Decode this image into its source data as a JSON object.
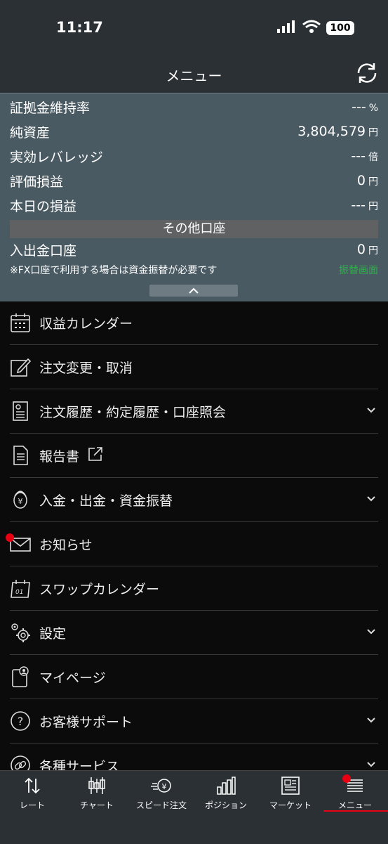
{
  "status": {
    "time": "11:17",
    "battery": "100"
  },
  "header": {
    "title": "メニュー"
  },
  "account": {
    "rows": [
      {
        "label": "証拠金維持率",
        "value": "---",
        "unit": "%"
      },
      {
        "label": "純資産",
        "value": "3,804,579",
        "unit": "円"
      },
      {
        "label": "実効レバレッジ",
        "value": "---",
        "unit": "倍"
      },
      {
        "label": "評価損益",
        "value": "0",
        "unit": "円"
      },
      {
        "label": "本日の損益",
        "value": "---",
        "unit": "円"
      }
    ],
    "other_header": "その他口座",
    "deposit": {
      "label": "入出金口座",
      "value": "0",
      "unit": "円"
    },
    "note": "※FX口座で利用する場合は資金振替が必要です",
    "transfer_link": "振替画面"
  },
  "menu": [
    {
      "label": "収益カレンダー",
      "icon": "calendar-icon"
    },
    {
      "label": "注文変更・取消",
      "icon": "edit-icon"
    },
    {
      "label": "注文履歴・約定履歴・口座照会",
      "icon": "history-doc-icon"
    },
    {
      "label": "報告書",
      "icon": "report-doc-icon"
    },
    {
      "label": "入金・出金・資金振替",
      "icon": "yen-coins-icon"
    },
    {
      "label": "お知らせ",
      "icon": "mail-icon"
    },
    {
      "label": "スワップカレンダー",
      "icon": "swap-calendar-icon"
    },
    {
      "label": "設定",
      "icon": "gear-icon"
    },
    {
      "label": "マイページ",
      "icon": "mypage-icon"
    },
    {
      "label": "お客様サポート",
      "icon": "support-icon"
    },
    {
      "label": "各種サービス",
      "icon": "link-icon"
    }
  ],
  "tabs": [
    {
      "label": "レート",
      "icon": "rate-arrows-icon"
    },
    {
      "label": "チャート",
      "icon": "candlestick-icon"
    },
    {
      "label": "スピード注文",
      "icon": "speed-order-icon"
    },
    {
      "label": "ポジション",
      "icon": "position-bars-icon"
    },
    {
      "label": "マーケット",
      "icon": "newspaper-icon"
    },
    {
      "label": "メニュー",
      "icon": "menu-lines-icon"
    }
  ]
}
